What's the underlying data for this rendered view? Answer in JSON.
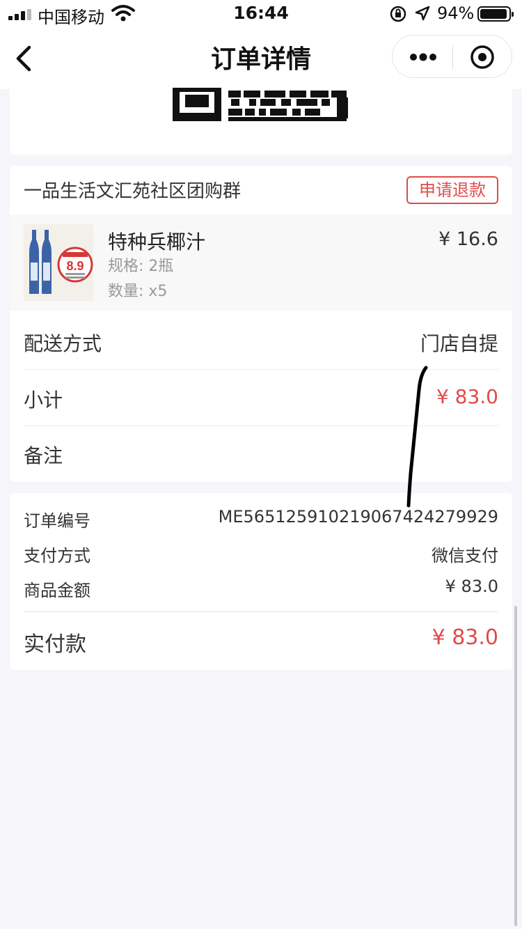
{
  "status_bar": {
    "carrier": "中国移动",
    "time": "16:44",
    "battery": "94%",
    "battery_level": 0.94
  },
  "nav": {
    "title": "订单详情",
    "back_icon": "chevron-left-icon",
    "more_icon": "more-dots-icon",
    "close_icon": "target-circle-icon"
  },
  "order": {
    "shop_name": "一品生活文汇苑社区团购群",
    "refund_label": "申请退款",
    "item": {
      "name": "特种兵椰汁",
      "spec": "规格: 2瓶",
      "quantity": "数量: x5",
      "price": "¥ 16.6",
      "thumb_badge": "8.9"
    },
    "delivery_label": "配送方式",
    "delivery_value": "门店自提",
    "subtotal_label": "小计",
    "subtotal_value": "¥ 83.0",
    "note_label": "备注"
  },
  "info": {
    "order_no_label": "订单编号",
    "order_no_value": "ME565125910219067424279929",
    "pay_method_label": "支付方式",
    "pay_method_value": "微信支付",
    "goods_amount_label": "商品金额",
    "goods_amount_value": "¥ 83.0",
    "paid_label": "实付款",
    "paid_value": "¥ 83.0"
  },
  "colors": {
    "accent_red": "#e24a4a",
    "background": "#f6f5fa"
  }
}
